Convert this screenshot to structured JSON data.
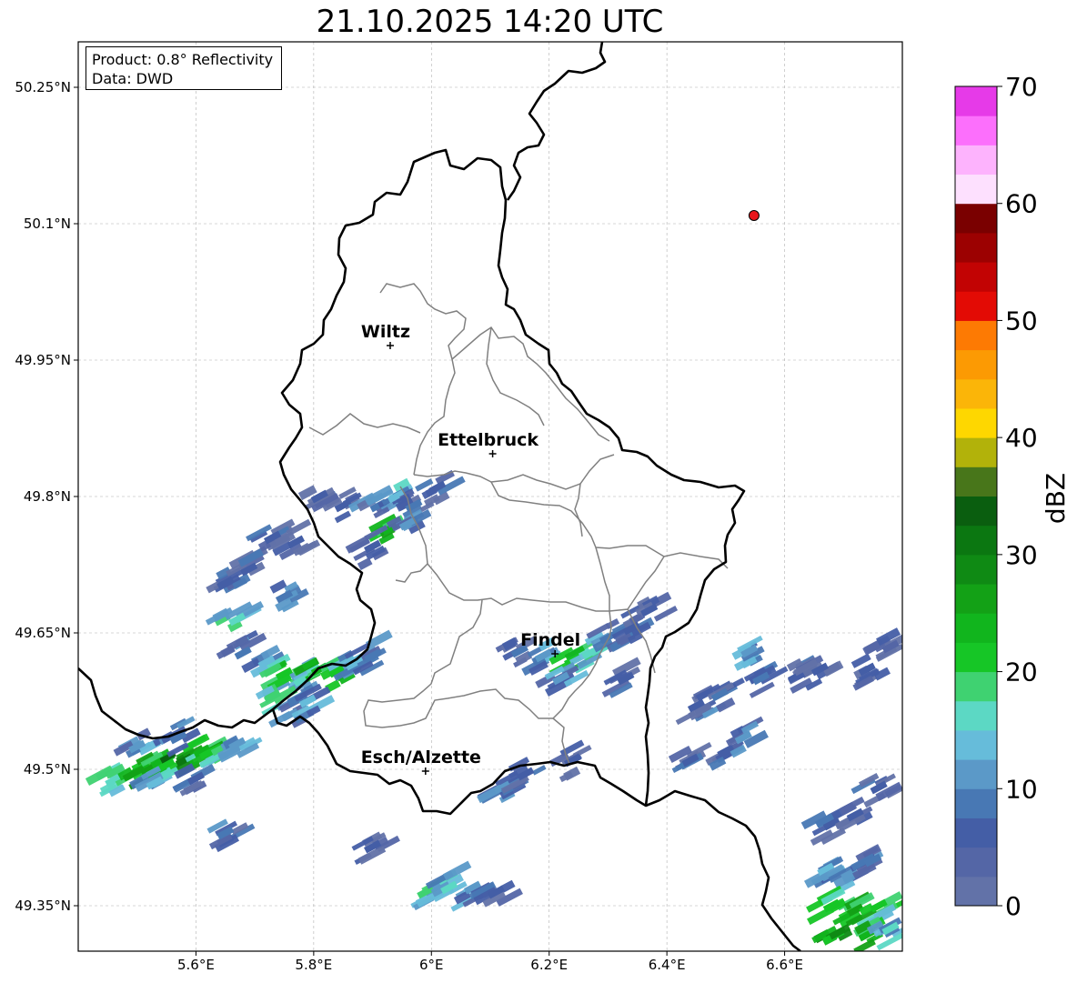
{
  "title": "21.10.2025 14:20 UTC",
  "info": {
    "product": "Product: 0.8° Reflectivity",
    "data": "Data: DWD"
  },
  "map": {
    "lon_range": [
      5.4,
      6.8
    ],
    "lat_range": [
      49.3,
      50.3
    ],
    "lon_ticks": [
      "5.6°E",
      "5.8°E",
      "6°E",
      "6.2°E",
      "6.4°E",
      "6.6°E"
    ],
    "lon_tick_values": [
      5.6,
      5.8,
      6.0,
      6.2,
      6.4,
      6.6
    ],
    "lat_ticks": [
      "50.25°N",
      "50.1°N",
      "49.95°N",
      "49.8°N",
      "49.65°N",
      "49.5°N",
      "49.35°N"
    ],
    "lat_tick_values": [
      50.25,
      50.1,
      49.95,
      49.8,
      49.65,
      49.5,
      49.35
    ],
    "grid": true,
    "cities": [
      {
        "name": "Wiltz",
        "lon": 5.93,
        "lat": 49.966
      },
      {
        "name": "Ettelbruck",
        "lon": 6.104,
        "lat": 49.847
      },
      {
        "name": "Findel",
        "lon": 6.21,
        "lat": 49.627
      },
      {
        "name": "Esch/Alzette",
        "lon": 5.99,
        "lat": 49.498
      }
    ],
    "radar_site": {
      "lon": 6.548,
      "lat": 50.109,
      "color": "#e8161b"
    }
  },
  "colorbar": {
    "label": "dBZ",
    "min": 0,
    "max": 70,
    "ticks": [
      "0",
      "10",
      "20",
      "30",
      "40",
      "50",
      "60",
      "70"
    ],
    "colors": [
      "#6272a8",
      "#5466a6",
      "#445ea6",
      "#4878b4",
      "#5b99c8",
      "#66bcda",
      "#5cd8c4",
      "#3fd271",
      "#16c626",
      "#11b51d",
      "#13a116",
      "#0f8a14",
      "#0b7711",
      "#0a5e0f",
      "#48761a",
      "#b2b20a",
      "#fed700",
      "#fbb508",
      "#fc9a03",
      "#fd7a03",
      "#e30b05",
      "#c20303",
      "#9c0101",
      "#7a0000",
      "#fde0fe",
      "#fdb3fd",
      "#fc6ffc",
      "#e63ae8"
    ]
  },
  "echoes": [
    {
      "lon": 5.46,
      "lat": 49.488,
      "v": 17
    },
    {
      "lon": 5.49,
      "lat": 49.494,
      "v": 23
    },
    {
      "lon": 5.52,
      "lat": 49.5,
      "v": 25
    },
    {
      "lon": 5.55,
      "lat": 49.505,
      "v": 21
    },
    {
      "lon": 5.58,
      "lat": 49.51,
      "v": 32
    },
    {
      "lon": 5.61,
      "lat": 49.52,
      "v": 24
    },
    {
      "lon": 5.64,
      "lat": 49.522,
      "v": 19
    },
    {
      "lon": 5.67,
      "lat": 49.528,
      "v": 12
    },
    {
      "lon": 5.53,
      "lat": 49.485,
      "v": 14
    },
    {
      "lon": 5.5,
      "lat": 49.525,
      "v": 10
    },
    {
      "lon": 5.57,
      "lat": 49.535,
      "v": 9
    },
    {
      "lon": 5.6,
      "lat": 49.49,
      "v": 6
    },
    {
      "lon": 5.65,
      "lat": 49.43,
      "v": 8
    },
    {
      "lon": 5.68,
      "lat": 49.628,
      "v": 8
    },
    {
      "lon": 5.72,
      "lat": 49.618,
      "v": 14
    },
    {
      "lon": 5.75,
      "lat": 49.605,
      "v": 21
    },
    {
      "lon": 5.78,
      "lat": 49.598,
      "v": 17
    },
    {
      "lon": 5.81,
      "lat": 49.61,
      "v": 24
    },
    {
      "lon": 5.84,
      "lat": 49.608,
      "v": 20
    },
    {
      "lon": 5.87,
      "lat": 49.62,
      "v": 13
    },
    {
      "lon": 5.9,
      "lat": 49.625,
      "v": 9
    },
    {
      "lon": 5.73,
      "lat": 49.58,
      "v": 19
    },
    {
      "lon": 5.76,
      "lat": 49.56,
      "v": 10
    },
    {
      "lon": 5.79,
      "lat": 49.575,
      "v": 13
    },
    {
      "lon": 5.67,
      "lat": 49.665,
      "v": 16
    },
    {
      "lon": 5.65,
      "lat": 49.705,
      "v": 7
    },
    {
      "lon": 5.69,
      "lat": 49.72,
      "v": 6
    },
    {
      "lon": 5.75,
      "lat": 49.69,
      "v": 9
    },
    {
      "lon": 5.73,
      "lat": 49.755,
      "v": 6
    },
    {
      "lon": 5.77,
      "lat": 49.75,
      "v": 5
    },
    {
      "lon": 5.81,
      "lat": 49.8,
      "v": 6
    },
    {
      "lon": 5.85,
      "lat": 49.79,
      "v": 5
    },
    {
      "lon": 5.91,
      "lat": 49.79,
      "v": 9
    },
    {
      "lon": 5.94,
      "lat": 49.8,
      "v": 13
    },
    {
      "lon": 5.97,
      "lat": 49.79,
      "v": 8
    },
    {
      "lon": 5.93,
      "lat": 49.765,
      "v": 24
    },
    {
      "lon": 5.96,
      "lat": 49.77,
      "v": 10
    },
    {
      "lon": 6.01,
      "lat": 49.81,
      "v": 7
    },
    {
      "lon": 5.9,
      "lat": 49.745,
      "v": 6
    },
    {
      "lon": 6.15,
      "lat": 49.63,
      "v": 8
    },
    {
      "lon": 6.19,
      "lat": 49.625,
      "v": 12
    },
    {
      "lon": 6.24,
      "lat": 49.62,
      "v": 22
    },
    {
      "lon": 6.27,
      "lat": 49.628,
      "v": 17
    },
    {
      "lon": 6.22,
      "lat": 49.6,
      "v": 11
    },
    {
      "lon": 6.3,
      "lat": 49.645,
      "v": 8
    },
    {
      "lon": 6.34,
      "lat": 49.655,
      "v": 6
    },
    {
      "lon": 6.37,
      "lat": 49.675,
      "v": 6
    },
    {
      "lon": 6.33,
      "lat": 49.6,
      "v": 5
    },
    {
      "lon": 6.12,
      "lat": 49.48,
      "v": 12
    },
    {
      "lon": 6.16,
      "lat": 49.495,
      "v": 7
    },
    {
      "lon": 6.24,
      "lat": 49.51,
      "v": 5
    },
    {
      "lon": 5.9,
      "lat": 49.415,
      "v": 5
    },
    {
      "lon": 5.99,
      "lat": 49.365,
      "v": 18
    },
    {
      "lon": 6.03,
      "lat": 49.37,
      "v": 15
    },
    {
      "lon": 6.07,
      "lat": 49.37,
      "v": 10
    },
    {
      "lon": 6.11,
      "lat": 49.365,
      "v": 6
    },
    {
      "lon": 6.45,
      "lat": 49.57,
      "v": 6
    },
    {
      "lon": 6.49,
      "lat": 49.582,
      "v": 9
    },
    {
      "lon": 6.56,
      "lat": 49.6,
      "v": 8
    },
    {
      "lon": 6.54,
      "lat": 49.63,
      "v": 12
    },
    {
      "lon": 6.62,
      "lat": 49.602,
      "v": 6
    },
    {
      "lon": 6.66,
      "lat": 49.61,
      "v": 5
    },
    {
      "lon": 6.74,
      "lat": 49.61,
      "v": 5
    },
    {
      "lon": 6.78,
      "lat": 49.635,
      "v": 4
    },
    {
      "lon": 6.44,
      "lat": 49.51,
      "v": 6
    },
    {
      "lon": 6.5,
      "lat": 49.52,
      "v": 7
    },
    {
      "lon": 6.53,
      "lat": 49.535,
      "v": 10
    },
    {
      "lon": 6.68,
      "lat": 49.44,
      "v": 7
    },
    {
      "lon": 6.72,
      "lat": 49.45,
      "v": 6
    },
    {
      "lon": 6.76,
      "lat": 49.48,
      "v": 5
    },
    {
      "lon": 6.67,
      "lat": 49.39,
      "v": 13
    },
    {
      "lon": 6.71,
      "lat": 49.385,
      "v": 11
    },
    {
      "lon": 6.75,
      "lat": 49.4,
      "v": 8
    },
    {
      "lon": 6.68,
      "lat": 49.35,
      "v": 22
    },
    {
      "lon": 6.72,
      "lat": 49.345,
      "v": 26
    },
    {
      "lon": 6.76,
      "lat": 49.35,
      "v": 20
    },
    {
      "lon": 6.69,
      "lat": 49.32,
      "v": 28
    },
    {
      "lon": 6.74,
      "lat": 49.318,
      "v": 24
    },
    {
      "lon": 6.78,
      "lat": 49.325,
      "v": 16
    }
  ]
}
